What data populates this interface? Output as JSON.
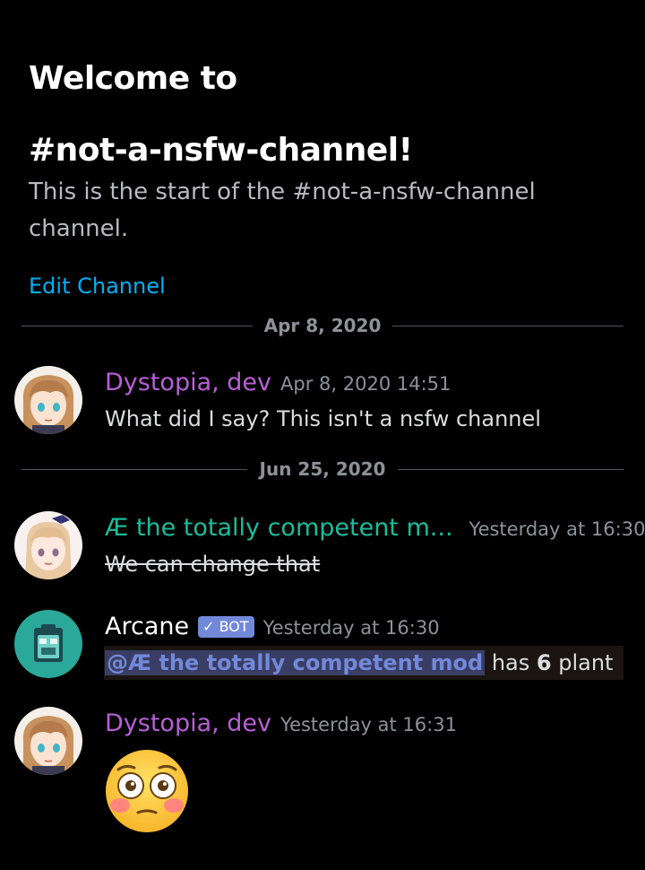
{
  "welcome": {
    "title_line1": "Welcome to",
    "title_line2": "#not-a-nsfw-channel!",
    "subtitle": "This is the start of the #not-a-nsfw-channel channel.",
    "edit_link": "Edit Channel"
  },
  "dividers": [
    {
      "label": "Apr 8, 2020"
    },
    {
      "label": "Jun 25, 2020"
    }
  ],
  "messages": [
    {
      "author": "Dystopia, dev",
      "author_color": "#b85fd6",
      "timestamp": "Apr 8, 2020 14:51",
      "text": "What did I say? This isn't a nsfw channel",
      "avatar_icon": "anime-avatar-icon"
    },
    {
      "author": "Æ the totally competent m...",
      "author_color": "#1abc9c",
      "timestamp": "Yesterday at 16:30",
      "text": "We can change that",
      "strikethrough": true,
      "avatar_icon": "anime-avatar-icon"
    },
    {
      "author": "Arcane",
      "author_color": "#ffffff",
      "badge": "BOT",
      "badge_icon": "checkmark-icon",
      "timestamp": "Yesterday at 16:30",
      "mention": "@Æ the totally competent mod",
      "text_after_mention": " has ",
      "count": "6",
      "text_end": " plant",
      "avatar_icon": "bot-avatar-icon"
    },
    {
      "author": "Dystopia, dev",
      "author_color": "#b85fd6",
      "timestamp": "Yesterday at 16:31",
      "emoji": "flushed-face-emoji",
      "avatar_icon": "anime-avatar-icon"
    }
  ],
  "colors": {
    "background": "#000000",
    "link": "#00b0f4",
    "mention_bg": "#3a3d63",
    "mention_fg": "#7289da",
    "bot_badge": "#7289da"
  }
}
